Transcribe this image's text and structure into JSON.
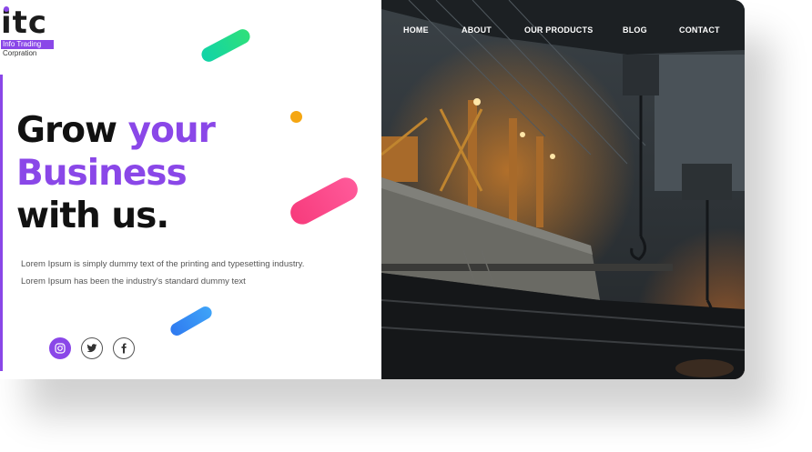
{
  "brand": {
    "mark": "itc",
    "tagline_line1": "Info Trading",
    "tagline_line2": "Corpration"
  },
  "nav": {
    "items": [
      "HOME",
      "ABOUT",
      "OUR PRODUCTS",
      "BLOG",
      "CONTACT"
    ]
  },
  "hero": {
    "line1_part1": "Grow ",
    "line1_part2": "your",
    "line2": "Business",
    "line3": "with us.",
    "description": "Lorem Ipsum is simply dummy text of the printing and typesetting industry. Lorem Ipsum has been the industry's standard dummy text"
  },
  "social": {
    "icons": [
      "instagram-icon",
      "twitter-icon",
      "facebook-icon"
    ]
  },
  "colors": {
    "accent": "#8a47e8",
    "green_pill": "#10d3a8",
    "pink_pill": "#f73b7c",
    "blue_pill": "#2f7af0",
    "orange_dot": "#f5a612"
  }
}
